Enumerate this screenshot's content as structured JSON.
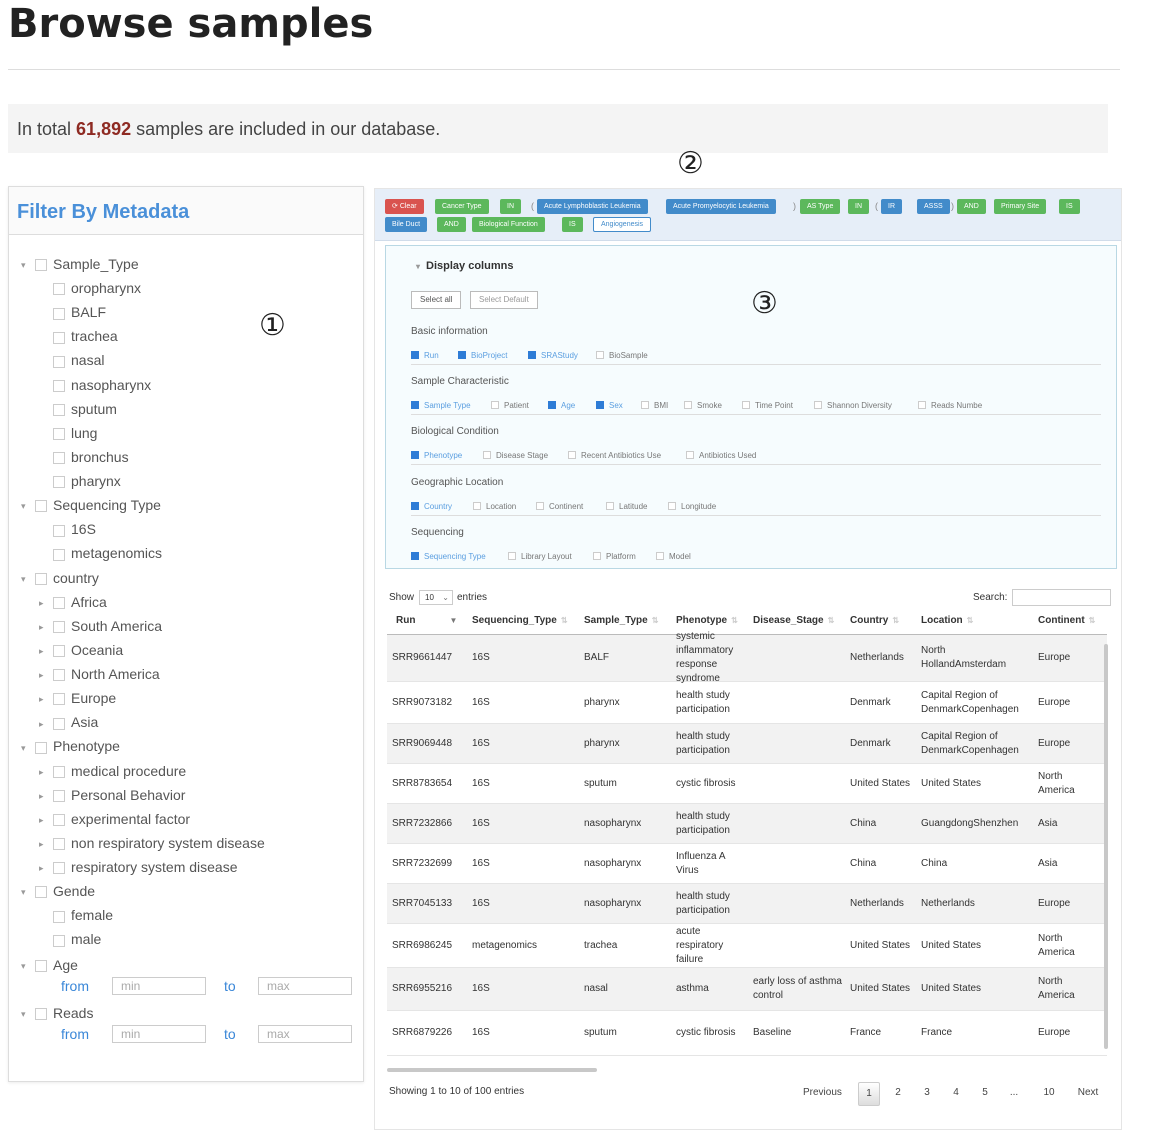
{
  "header": {
    "title": "Browse samples",
    "total_prefix": "In total ",
    "total_count": "61,892",
    "total_suffix": " samples are included in our database."
  },
  "annotations": {
    "one": "①",
    "two": "②",
    "three": "③"
  },
  "filter": {
    "heading": "Filter By Metadata",
    "nodes": [
      {
        "label": "Sample_Type",
        "level": 0,
        "arrow": "▾"
      },
      {
        "label": "oropharynx",
        "level": 1,
        "arrow": ""
      },
      {
        "label": "BALF",
        "level": 1,
        "arrow": ""
      },
      {
        "label": "trachea",
        "level": 1,
        "arrow": ""
      },
      {
        "label": "nasal",
        "level": 1,
        "arrow": ""
      },
      {
        "label": "nasopharynx",
        "level": 1,
        "arrow": ""
      },
      {
        "label": "sputum",
        "level": 1,
        "arrow": ""
      },
      {
        "label": "lung",
        "level": 1,
        "arrow": ""
      },
      {
        "label": "bronchus",
        "level": 1,
        "arrow": ""
      },
      {
        "label": "pharynx",
        "level": 1,
        "arrow": ""
      },
      {
        "label": "Sequencing Type",
        "level": 0,
        "arrow": "▾"
      },
      {
        "label": "16S",
        "level": 1,
        "arrow": ""
      },
      {
        "label": "metagenomics",
        "level": 1,
        "arrow": ""
      },
      {
        "label": "country",
        "level": 0,
        "arrow": "▾"
      },
      {
        "label": "Africa",
        "level": 1,
        "arrow": "▸"
      },
      {
        "label": "South America",
        "level": 1,
        "arrow": "▸"
      },
      {
        "label": "Oceania",
        "level": 1,
        "arrow": "▸"
      },
      {
        "label": "North America",
        "level": 1,
        "arrow": "▸"
      },
      {
        "label": "Europe",
        "level": 1,
        "arrow": "▸"
      },
      {
        "label": "Asia",
        "level": 1,
        "arrow": "▸"
      },
      {
        "label": "Phenotype",
        "level": 0,
        "arrow": "▾"
      },
      {
        "label": "medical procedure",
        "level": 1,
        "arrow": "▸"
      },
      {
        "label": "Personal Behavior",
        "level": 1,
        "arrow": "▸"
      },
      {
        "label": "experimental factor",
        "level": 1,
        "arrow": "▸"
      },
      {
        "label": "non respiratory system disease",
        "level": 1,
        "arrow": "▸"
      },
      {
        "label": "respiratory system disease",
        "level": 1,
        "arrow": "▸"
      },
      {
        "label": "Gende",
        "level": 0,
        "arrow": "▾"
      },
      {
        "label": "female",
        "level": 1,
        "arrow": ""
      },
      {
        "label": "male",
        "level": 1,
        "arrow": ""
      },
      {
        "label": "Age",
        "level": 0,
        "arrow": "▾"
      },
      {
        "label": "Reads",
        "level": 0,
        "arrow": "▾"
      }
    ],
    "age_range": {
      "from": "from",
      "to": "to",
      "min": "min",
      "max": "max"
    },
    "reads_range": {
      "from": "from",
      "to": "to",
      "min": "min",
      "max": "max"
    }
  },
  "chips": [
    {
      "label": "Clear",
      "kind": "red"
    },
    {
      "label": "Cancer Type",
      "kind": "green"
    },
    {
      "label": "IN",
      "kind": "green"
    },
    {
      "label": "(",
      "kind": "paren"
    },
    {
      "label": "Acute Lymphoblastic Leukemia",
      "kind": "blue"
    },
    {
      "label": "Acute Promyelocytic Leukemia",
      "kind": "blue"
    },
    {
      "label": ")",
      "kind": "paren"
    },
    {
      "label": "AS Type",
      "kind": "green"
    },
    {
      "label": "IN",
      "kind": "green"
    },
    {
      "label": "(",
      "kind": "paren"
    },
    {
      "label": "IR",
      "kind": "blue"
    },
    {
      "label": "ASSS",
      "kind": "blue"
    },
    {
      "label": ")",
      "kind": "paren"
    },
    {
      "label": "AND",
      "kind": "green"
    },
    {
      "label": "Primary Site",
      "kind": "green"
    },
    {
      "label": "IS",
      "kind": "green"
    },
    {
      "label": "Bile Duct",
      "kind": "blue"
    },
    {
      "label": "AND",
      "kind": "green"
    },
    {
      "label": "Biological Function",
      "kind": "green"
    },
    {
      "label": "IS",
      "kind": "green"
    },
    {
      "label": "Angiogenesis",
      "kind": "outline"
    }
  ],
  "colors": {
    "red": "#d9534f",
    "green": "#5cb85c",
    "blue": "#428bca"
  },
  "display_columns": {
    "heading": "Display columns",
    "select_all": "Select all",
    "select_default": "Select Default",
    "sections": [
      {
        "title": "Basic information",
        "options": [
          {
            "label": "Run",
            "checked": true
          },
          {
            "label": "BioProject",
            "checked": true
          },
          {
            "label": "SRAStudy",
            "checked": true
          },
          {
            "label": "BioSample",
            "checked": false
          }
        ]
      },
      {
        "title": "Sample Characteristic",
        "options": [
          {
            "label": "Sample Type",
            "checked": true
          },
          {
            "label": "Patient",
            "checked": false
          },
          {
            "label": "Age",
            "checked": true
          },
          {
            "label": "Sex",
            "checked": true
          },
          {
            "label": "BMI",
            "checked": false
          },
          {
            "label": "Smoke",
            "checked": false
          },
          {
            "label": "Time Point",
            "checked": false
          },
          {
            "label": "Shannon Diversity",
            "checked": false
          },
          {
            "label": "Reads Numbe",
            "checked": false
          }
        ]
      },
      {
        "title": "Biological Condition",
        "options": [
          {
            "label": "Phenotype",
            "checked": true
          },
          {
            "label": "Disease Stage",
            "checked": false
          },
          {
            "label": "Recent Antibiotics Use",
            "checked": false
          },
          {
            "label": "Antibiotics Used",
            "checked": false
          }
        ]
      },
      {
        "title": "Geographic Location",
        "options": [
          {
            "label": "Country",
            "checked": true
          },
          {
            "label": "Location",
            "checked": false
          },
          {
            "label": "Continent",
            "checked": false
          },
          {
            "label": "Latitude",
            "checked": false
          },
          {
            "label": "Longitude",
            "checked": false
          }
        ]
      },
      {
        "title": "Sequencing",
        "options": [
          {
            "label": "Sequencing Type",
            "checked": true
          },
          {
            "label": "Library Layout",
            "checked": false
          },
          {
            "label": "Platform",
            "checked": false
          },
          {
            "label": "Model",
            "checked": false
          }
        ]
      }
    ]
  },
  "table": {
    "show_label": "Show",
    "show_value": "10",
    "entries_label": "entries",
    "search_label": "Search:",
    "columns": [
      "Run",
      "Sequencing_Type",
      "Sample_Type",
      "Phenotype",
      "Disease_Stage",
      "Country",
      "Location",
      "Continent"
    ],
    "rows": [
      [
        "SRR9661447",
        "16S",
        "BALF",
        "systemic inflammatory response syndrome",
        "",
        "Netherlands",
        "North HollandAmsterdam",
        "Europe"
      ],
      [
        "SRR9073182",
        "16S",
        "pharynx",
        "health study participation",
        "",
        "Denmark",
        "Capital Region of DenmarkCopenhagen",
        "Europe"
      ],
      [
        "SRR9069448",
        "16S",
        "pharynx",
        "health study participation",
        "",
        "Denmark",
        "Capital Region of DenmarkCopenhagen",
        "Europe"
      ],
      [
        "SRR8783654",
        "16S",
        "sputum",
        "cystic fibrosis",
        "",
        "United States",
        "United States",
        "North America"
      ],
      [
        "SRR7232866",
        "16S",
        "nasopharynx",
        "health study participation",
        "",
        "China",
        "GuangdongShenzhen",
        "Asia"
      ],
      [
        "SRR7232699",
        "16S",
        "nasopharynx",
        "Influenza A Virus",
        "",
        "China",
        "China",
        "Asia"
      ],
      [
        "SRR7045133",
        "16S",
        "nasopharynx",
        "health study participation",
        "",
        "Netherlands",
        "Netherlands",
        "Europe"
      ],
      [
        "SRR6986245",
        "metagenomics",
        "trachea",
        "acute respiratory failure",
        "",
        "United States",
        "United States",
        "North America"
      ],
      [
        "SRR6955216",
        "16S",
        "nasal",
        "asthma",
        "early loss of asthma control",
        "United States",
        "United States",
        "North America"
      ],
      [
        "SRR6879226",
        "16S",
        "sputum",
        "cystic fibrosis",
        "Baseline",
        "France",
        "France",
        "Europe"
      ]
    ],
    "info": "Showing 1 to 10 of 100 entries",
    "pagination": [
      "Previous",
      "1",
      "2",
      "3",
      "4",
      "5",
      "...",
      "10",
      "Next"
    ],
    "current_page": "1"
  }
}
